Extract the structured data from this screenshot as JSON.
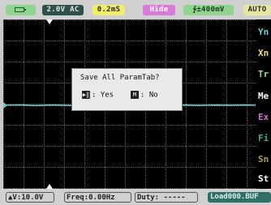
{
  "top_bar": {
    "battery_icon": "battery-icon",
    "coupling": "2.0V AC",
    "timebase": "0.2mS",
    "hide_label": "Hide",
    "trigger": "∱±400mV",
    "mode": "AUTO"
  },
  "dialog": {
    "title": "Save All ParamTab?",
    "yes_key": "▶‖",
    "yes_label": ": Yes",
    "no_key": "M",
    "no_label": ": No"
  },
  "side_menu": {
    "items": [
      {
        "label": "Yn",
        "color": "#6fd0d0"
      },
      {
        "label": "Xn",
        "color": "#f0e070"
      },
      {
        "label": "Tr",
        "color": "#90e090"
      },
      {
        "label": "Me",
        "color": "#ffffff"
      },
      {
        "label": "Ex",
        "color": "#d070d0"
      },
      {
        "label": "Fi",
        "color": "#40b090"
      },
      {
        "label": "Sn",
        "color": "#b0a050"
      },
      {
        "label": "St",
        "color": "#ffffff"
      }
    ]
  },
  "bottom_bar": {
    "voltage": "▲V:10.0V",
    "frequency": "Freq:0.00Hz",
    "duty": "Duty: -----",
    "file": "Load000.BUF"
  },
  "colors": {
    "trace": "#6ec9c4",
    "screen_bg": "#000000",
    "grid": "#6a6a6a"
  }
}
